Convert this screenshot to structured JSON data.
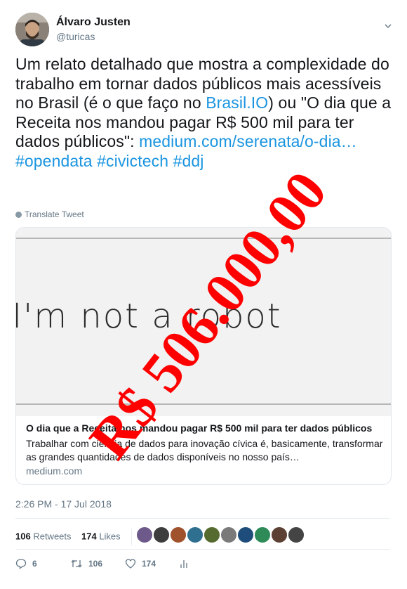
{
  "author": {
    "name": "Álvaro Justen",
    "handle": "@turicas"
  },
  "menu": {
    "icon": "chevron-down-icon"
  },
  "tweet": {
    "text_1": "Um relato detalhado que mostra a complexidade do trabalho em tornar dados públicos mais acessíveis no Brasil (é o que faço no ",
    "link_brasil": "Brasil.IO",
    "text_2": ") ou \"O dia que a Receita nos mandou pagar R$ 500 mil para ter dados públicos\": ",
    "link_medium": "medium.com/serenata/o-dia…",
    "hashtags": "#opendata #civictech #ddj"
  },
  "translate": {
    "label": "Translate Tweet",
    "icon": "globe-icon"
  },
  "card": {
    "image_text": "I'm not a robot",
    "title": "O dia que a Receita nos mandou pagar R$ 500 mil para ter dados públicos",
    "description": "Trabalhar com ciência de dados para inovação cívica é, basicamente, transformar as grandes quantidades de dados disponíveis no nosso país…",
    "domain": "medium.com"
  },
  "timestamp": "2:26 PM - 17 Jul 2018",
  "stats": {
    "retweets_count": "106",
    "retweets_label": "Retweets",
    "likes_count": "174",
    "likes_label": "Likes"
  },
  "likers": {
    "count": 10
  },
  "actions": {
    "reply": {
      "icon": "reply-icon",
      "count": "6"
    },
    "retweet": {
      "icon": "retweet-icon",
      "count": "106"
    },
    "like": {
      "icon": "heart-icon",
      "count": "174"
    },
    "analytics": {
      "icon": "analytics-icon"
    }
  },
  "stamp": {
    "text": "R$ 506.000,00",
    "color": "#ff0000"
  },
  "colors": {
    "link": "#1b95e0",
    "secondary": "#657786",
    "border": "#e1e8ed"
  }
}
